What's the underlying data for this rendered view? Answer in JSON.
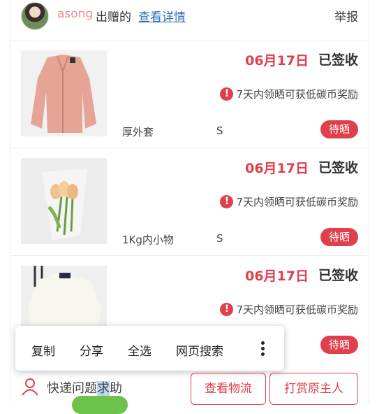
{
  "header": {
    "sender": "asong",
    "gift_text": "出赠的",
    "detail_link": "查看详情",
    "report": "举报"
  },
  "items": [
    {
      "date": "06月17日",
      "status": "已签收",
      "notice": "7天内领晒可获低碳币奖励",
      "name": "厚外套",
      "size": "S",
      "badge": "待晒",
      "image": "pink-jacket"
    },
    {
      "date": "06月17日",
      "status": "已签收",
      "notice": "7天内领晒可获低碳币奖励",
      "name": "1Kg内小物",
      "size": "S",
      "badge": "待晒",
      "image": "tulip-bouquet"
    },
    {
      "date": "06月17日",
      "status": "已签收",
      "notice": "7天内领晒可获低碳币奖励",
      "name": "",
      "size": "",
      "badge": "待晒",
      "image": "white-blouse"
    }
  ],
  "context_menu": {
    "copy": "复制",
    "share": "分享",
    "select_all": "全选",
    "web_search": "网页搜索"
  },
  "footer": {
    "help_before": "快递问题",
    "help_selected": "求",
    "help_after": "助",
    "track_button": "查看物流",
    "tip_button": "打赏原主人"
  },
  "colors": {
    "accent": "#e0404b",
    "link": "#2f6eb5",
    "selection": "#b7d8f5"
  }
}
